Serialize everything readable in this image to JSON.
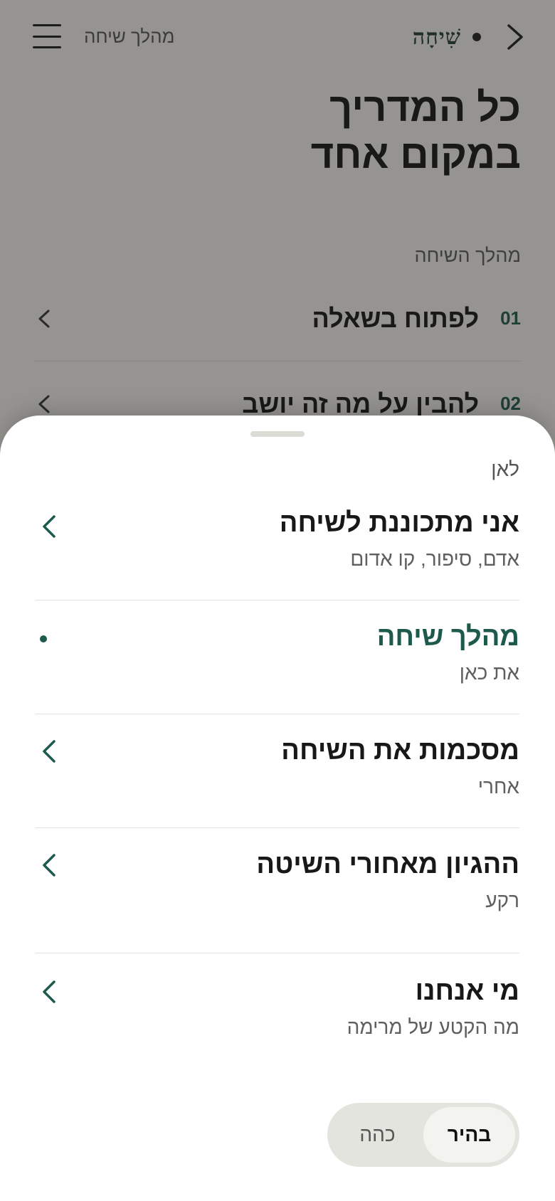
{
  "header": {
    "page_title": "מהלך שיחה",
    "logo_text": "שִׁיחָה"
  },
  "hero": {
    "line1": "כל המדריך",
    "line2": "במקום אחד"
  },
  "steps_section": {
    "label": "מהלך השיחה",
    "steps": [
      {
        "num": "01",
        "title": "לפתוח בשאלה"
      },
      {
        "num": "02",
        "title": "להבין על מה זה יושב"
      }
    ]
  },
  "sheet": {
    "label": "לאן",
    "items": [
      {
        "title": "אני מתכוננת לשיחה",
        "subtitle": "אדם, סיפור, קו אדום",
        "icon": "chevron-left-icon"
      },
      {
        "title": "מהלך שיחה",
        "subtitle": "את כאן",
        "icon": "current-dot-icon"
      },
      {
        "title": "מסכמות את השיחה",
        "subtitle": "אחרי",
        "icon": "chevron-left-icon"
      },
      {
        "title": "ההגיון מאחורי השיטה",
        "subtitle": "רקע",
        "icon": "chevron-left-icon"
      },
      {
        "title": "מי אנחנו",
        "subtitle": "מה הקטע של מרימה",
        "icon": "chevron-left-icon"
      }
    ],
    "theme_toggle": {
      "light_label": "בהיר",
      "dark_label": "כהה",
      "selected": "בהיר"
    }
  },
  "colors": {
    "accent": "#1d5a4c",
    "sheet_bg": "#ffffff",
    "page_bg": "#f6f5f0"
  }
}
